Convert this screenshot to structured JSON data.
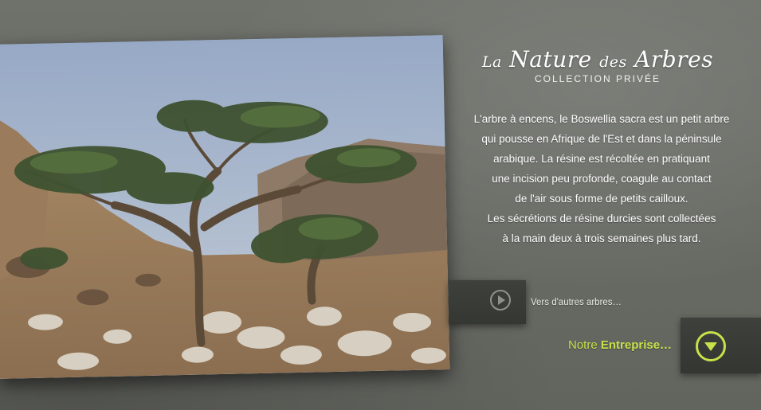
{
  "header": {
    "title_part1": "La",
    "title_part2": "Nature",
    "title_part3": "des",
    "title_part4": "Arbres",
    "subtitle": "COLLECTION PRIVÉE"
  },
  "description": {
    "lines": [
      "L'arbre à encens, le Boswellia sacra est un petit arbre",
      "qui pousse en Afrique de l'Est et dans la péninsule",
      "arabique. La résine est récoltée en pratiquant",
      "une incision peu profonde, coagule au contact",
      "de l'air sous forme de petits cailloux.",
      "Les sécrétions de résine durcies sont collectées",
      "à la main deux à trois semaines plus tard."
    ]
  },
  "links": {
    "video_label": "Vers d'autres arbres…",
    "company_prefix": "Notre ",
    "company_bold": "Entreprise…"
  },
  "icons": {
    "play": "play-icon",
    "down": "down-arrow-icon"
  },
  "colors": {
    "accent": "#c7e14b",
    "background": "#6a6c66",
    "button": "#3a3c38"
  }
}
